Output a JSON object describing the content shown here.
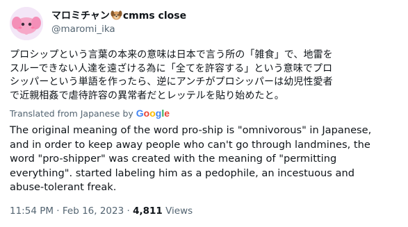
{
  "author": {
    "display_name": "マロミチャン",
    "display_name_suffix": "cmms close",
    "emoji_icon": "dog-face-icon",
    "handle": "@maromi_ika",
    "avatar_icon": "pink-elephant-avatar"
  },
  "tweet": {
    "original_lines": [
      "プロシップという言葉の本来の意味は日本で言う所の「雑食」で、地雷を",
      "スルーできない人達を遠ざける為に「全てを許容する」という意味でプロ",
      "シッパーという単語を作ったら、逆にアンチがプロシッパーは幼児性愛者",
      "で近親相姦で虐待許容の異常者だとレッテルを貼り始めたと。"
    ],
    "translated_from": "Translated from Japanese by",
    "translator_brand": [
      "G",
      "o",
      "o",
      "g",
      "l",
      "e"
    ],
    "translation_lines": [
      "The original meaning of the word pro-ship is \"omnivorous\" in Japanese,",
      "and in order to keep away people who can't go through landmines, the",
      "word \"pro-shipper\" was created with the meaning of \"permitting",
      "everything\". started labeling him as a pedophile, an incestuous and",
      "abuse-tolerant freak."
    ]
  },
  "meta": {
    "time": "11:54 PM",
    "separator": "·",
    "date": "Feb 16, 2023",
    "views_count": "4,811",
    "views_label": "Views"
  }
}
